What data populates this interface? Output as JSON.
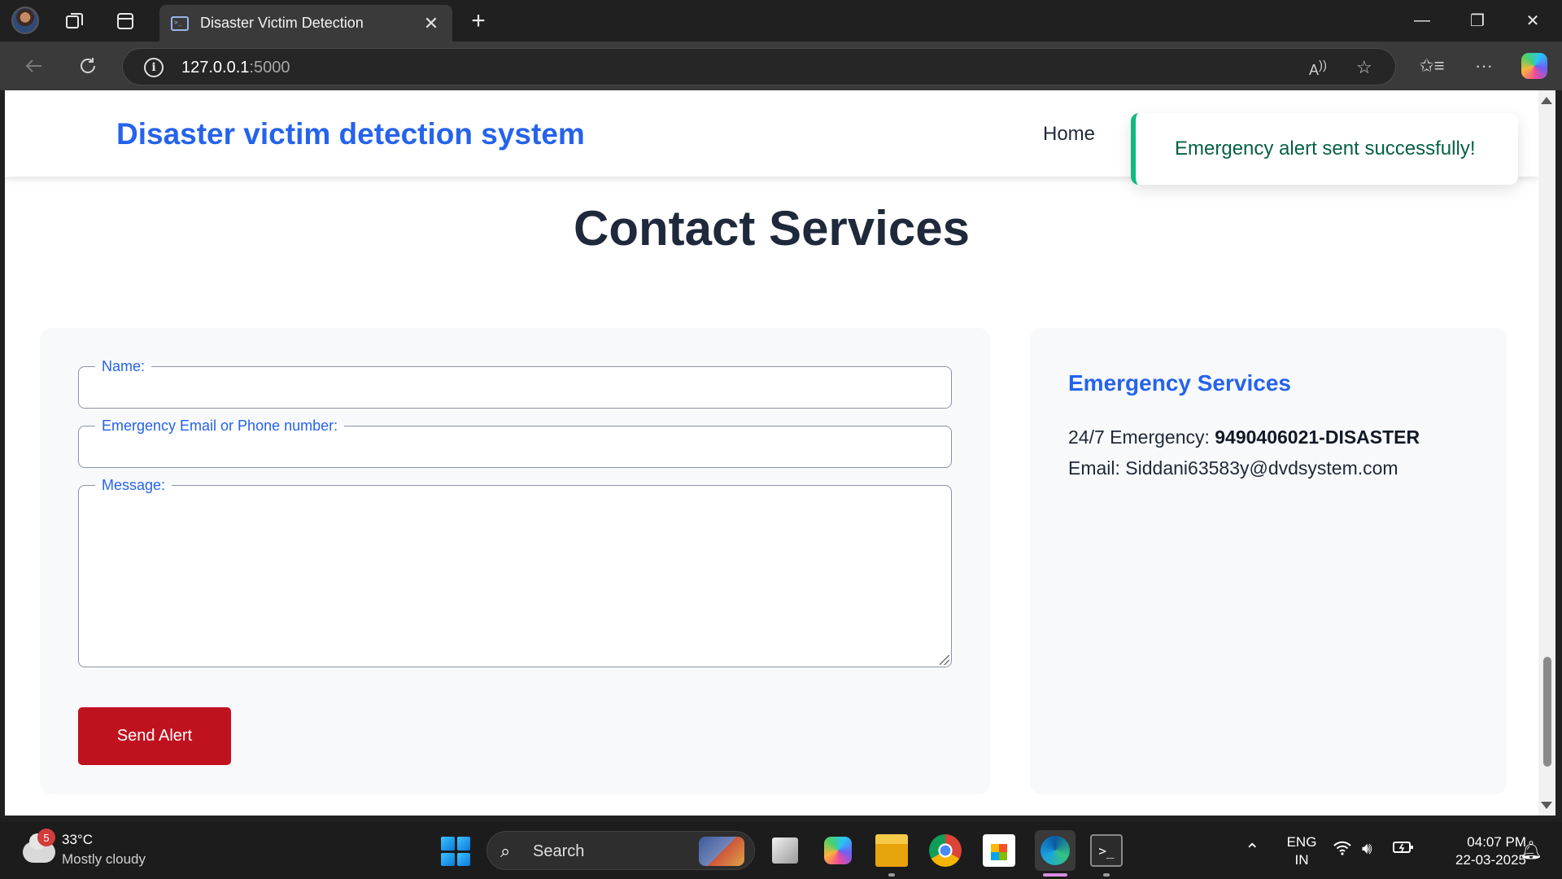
{
  "browser": {
    "tab_title": "Disaster Victim Detection",
    "tab_close": "✕",
    "new_tab": "+",
    "url_host": "127.0.0.1",
    "url_port": ":5000",
    "window_controls": {
      "minimize": "—",
      "restore": "❐",
      "close": "✕"
    },
    "icons": [
      "profile-avatar",
      "workspaces-icon",
      "tab-actions-icon",
      "back-icon",
      "refresh-icon",
      "site-info-icon",
      "read-aloud-icon",
      "favorite-star-icon",
      "favorites-icon",
      "more-icon",
      "copilot-icon"
    ]
  },
  "site": {
    "brand": "Disaster victim detection system",
    "nav_home": "Home",
    "toast": "Emergency alert sent successfully!",
    "title": "Contact Services"
  },
  "form": {
    "name_label": "Name:",
    "name_value": "",
    "contact_label": "Emergency Email or Phone number:",
    "contact_value": "",
    "message_label": "Message:",
    "message_value": "",
    "submit_label": "Send Alert"
  },
  "emergency": {
    "title": "Emergency Services",
    "phone_label": "24/7 Emergency:",
    "phone_value": "9490406021-DISASTER",
    "email_label": "Email:",
    "email_value": "Siddani63583y@dvdsystem.com"
  },
  "taskbar": {
    "weather_badge": "5",
    "weather_temp": "33°C",
    "weather_desc": "Mostly cloudy",
    "search_placeholder": "Search",
    "lang_line1": "ENG",
    "lang_line2": "IN",
    "time": "04:07 PM",
    "date": "22-03-2025"
  },
  "colors": {
    "accent_blue": "#2563eb",
    "alert_red": "#c0121e",
    "toast_green": "#10b981",
    "title_dark": "#1e293b"
  }
}
